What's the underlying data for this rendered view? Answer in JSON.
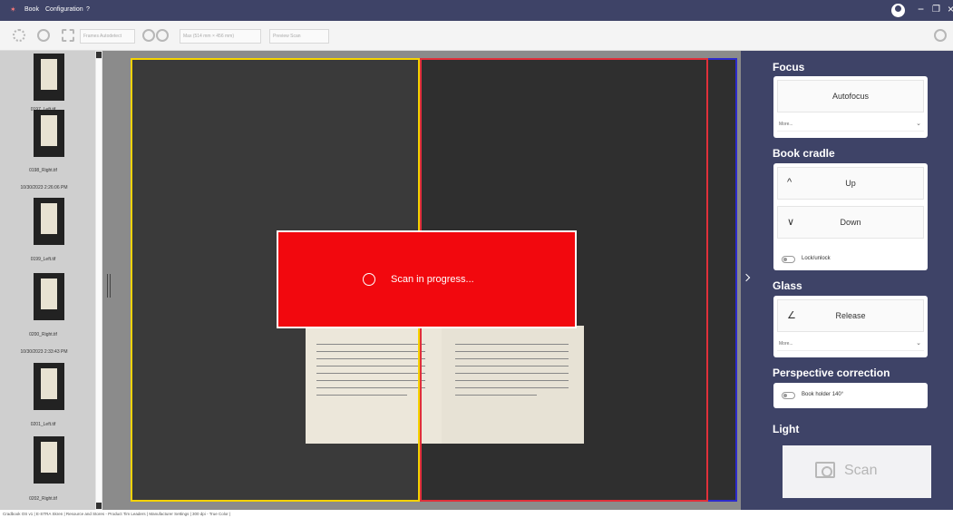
{
  "titlebar": {
    "logo": "✶",
    "menu": [
      "Book",
      "Configuration",
      "?"
    ],
    "minimize": "−",
    "restore": "❐",
    "close": "×"
  },
  "toolbar": {
    "frame_select": "Frames Autodetect",
    "size_select": "Max (514 mm × 456 mm)",
    "preview_select": "Preview Scan"
  },
  "thumbnails": [
    {
      "label": "0197_Left.tif"
    },
    {
      "label": "0198_Right.tif"
    },
    {
      "label": "0199_Left.tif"
    },
    {
      "label": "0200_Right.tif"
    },
    {
      "label": "0201_Left.tif"
    },
    {
      "label": "0202_Right.tif"
    }
  ],
  "thumbnail_dates": [
    "10/30/2023 2:26:06 PM",
    "10/30/2023 2:33:43 PM"
  ],
  "overlay": {
    "text": "Scan in progress..."
  },
  "panel": {
    "focus": {
      "title": "Focus",
      "button": "Autofocus",
      "dropdown": "More..."
    },
    "cradle": {
      "title": "Book cradle",
      "up_icon": "^",
      "up": "Up",
      "down_icon": "∨",
      "down": "Down",
      "toggle": "Lock/unlock"
    },
    "glass": {
      "title": "Glass",
      "release_icon": "∠",
      "release": "Release",
      "dropdown": "More..."
    },
    "perspective": {
      "title": "Perspective correction",
      "toggle": "Book holder 140°"
    },
    "light": {
      "title": "Light"
    },
    "scan": {
      "label": "Scan"
    }
  },
  "statusbar": {
    "text": "Cradbook OS v1 | E-STRA Skren | Resource and Stores - Product Tim Leaders | Manufacturer Settings | 300 dpi - True Color |"
  },
  "colors": {
    "titlebar": "#3e4367",
    "overlay": "#f2080e",
    "frame_left": "#f5d300",
    "frame_right": "#e0303a",
    "frame_outer": "#2d2bcc"
  }
}
